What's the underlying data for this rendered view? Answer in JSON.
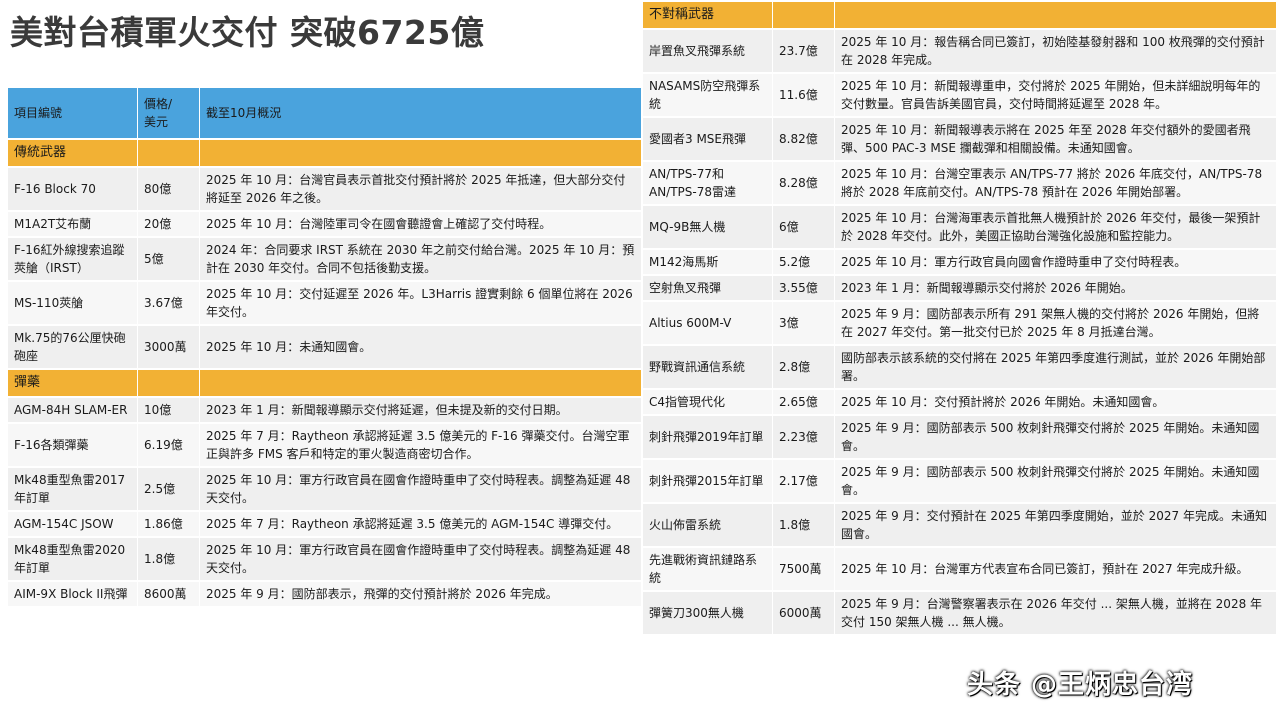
{
  "title": "美對台積軍火交付 突破6725億",
  "headers": {
    "item": "項目編號",
    "price": "價格/\n美元",
    "status": "截至10月概況"
  },
  "left": [
    {
      "type": "cat",
      "label": "傳統武器"
    },
    {
      "type": "row",
      "name": "F-16 Block 70",
      "price": "80億",
      "status": "2025 年 10 月：台灣官員表示首批交付預計將於 2025 年抵達，但大部分交付將延至 2026 年之後。"
    },
    {
      "type": "row",
      "name": "M1A2T艾布蘭",
      "price": "20億",
      "status": "2025 年 10 月：台灣陸軍司令在國會聽證會上確認了交付時程。"
    },
    {
      "type": "row",
      "name": "F-16紅外線搜索追蹤莢艙（IRST）",
      "price": "5億",
      "status": "2024 年：合同要求 IRST 系統在 2030 年之前交付給台灣。2025 年 10 月：預計在 2030 年交付。合同不包括後勤支援。"
    },
    {
      "type": "row",
      "name": "MS-110莢艙",
      "price": "3.67億",
      "status": "2025 年 10 月：交付延遲至 2026 年。L3Harris 證實剩餘 6 個單位將在 2026 年交付。"
    },
    {
      "type": "row",
      "name": "Mk.75的76公厘快砲砲座",
      "price": "3000萬",
      "status": "2025 年 10 月：未通知國會。"
    },
    {
      "type": "cat",
      "label": "彈藥"
    },
    {
      "type": "row",
      "name": "AGM-84H SLAM-ER",
      "price": "10億",
      "status": "2023 年 1 月：新聞報導顯示交付將延遲，但未提及新的交付日期。"
    },
    {
      "type": "row",
      "name": "F-16各類彈藥",
      "price": "6.19億",
      "status": "2025 年 7 月：Raytheon 承認將延遲 3.5 億美元的 F-16 彈藥交付。台灣空軍正與許多 FMS 客戶和特定的軍火製造商密切合作。"
    },
    {
      "type": "row",
      "name": "Mk48重型魚雷2017年訂單",
      "price": "2.5億",
      "status": "2025 年 10 月：軍方行政官員在國會作證時重申了交付時程表。調整為延遲 48 天交付。"
    },
    {
      "type": "row",
      "name": "AGM-154C JSOW",
      "price": "1.86億",
      "status": "2025 年 7 月：Raytheon 承認將延遲 3.5 億美元的 AGM-154C 導彈交付。"
    },
    {
      "type": "row",
      "name": "Mk48重型魚雷2020年訂單",
      "price": "1.8億",
      "status": "2025 年 10 月：軍方行政官員在國會作證時重申了交付時程表。調整為延遲 48 天交付。"
    },
    {
      "type": "row",
      "name": "AIM-9X Block II飛彈",
      "price": "8600萬",
      "status": "2025 年 9 月：國防部表示，飛彈的交付預計將於 2026 年完成。"
    }
  ],
  "right": [
    {
      "type": "cat",
      "label": "不對稱武器"
    },
    {
      "type": "row",
      "name": "岸置魚叉飛彈系統",
      "price": "23.7億",
      "status": "2025 年 10 月：報告稱合同已簽訂，初始陸基發射器和 100 枚飛彈的交付預計在 2028 年完成。"
    },
    {
      "type": "row",
      "name": "NASAMS防空飛彈系統",
      "price": "11.6億",
      "status": "2025 年 10 月：新聞報導重申，交付將於 2025 年開始，但未詳細說明每年的交付數量。官員告訴美國官員，交付時間將延遲至 2028 年。"
    },
    {
      "type": "row",
      "name": "愛國者3 MSE飛彈",
      "price": "8.82億",
      "status": "2025 年 10 月：新聞報導表示將在 2025 年至 2028 年交付額外的愛國者飛彈、500 PAC-3 MSE 攔截彈和相關設備。未通知國會。"
    },
    {
      "type": "row",
      "name": "AN/TPS-77和AN/TPS-78雷達",
      "price": "8.28億",
      "status": "2025 年 10 月：台灣空軍表示 AN/TPS-77 將於 2026 年底交付，AN/TPS-78 將於 2028 年底前交付。AN/TPS-78 預計在 2026 年開始部署。"
    },
    {
      "type": "row",
      "name": "MQ-9B無人機",
      "price": "6億",
      "status": "2025 年 10 月：台灣海軍表示首批無人機預計於 2026 年交付，最後一架預計於 2028 年交付。此外，美國正協助台灣強化設施和監控能力。"
    },
    {
      "type": "row",
      "name": "M142海馬斯",
      "price": "5.2億",
      "status": "2025 年 10 月：軍方行政官員向國會作證時重申了交付時程表。"
    },
    {
      "type": "row",
      "name": "空射魚叉飛彈",
      "price": "3.55億",
      "status": "2023 年 1 月：新聞報導顯示交付將於 2026 年開始。"
    },
    {
      "type": "row",
      "name": "Altius 600M-V",
      "price": "3億",
      "status": "2025 年 9 月：國防部表示所有 291 架無人機的交付將於 2026 年開始，但將在 2027 年交付。第一批交付已於 2025 年 8 月抵達台灣。"
    },
    {
      "type": "row",
      "name": "野戰資訊通信系統",
      "price": "2.8億",
      "status": "國防部表示該系統的交付將在 2025 年第四季度進行測試，並於 2026 年開始部署。"
    },
    {
      "type": "row",
      "name": "C4指管現代化",
      "price": "2.65億",
      "status": "2025 年 10 月：交付預計將於 2026 年開始。未通知國會。"
    },
    {
      "type": "row",
      "name": "刺針飛彈2019年訂單",
      "price": "2.23億",
      "status": "2025 年 9 月：國防部表示 500 枚刺針飛彈交付將於 2025 年開始。未通知國會。"
    },
    {
      "type": "row",
      "name": "刺針飛彈2015年訂單",
      "price": "2.17億",
      "status": "2025 年 9 月：國防部表示 500 枚刺針飛彈交付將於 2025 年開始。未通知國會。"
    },
    {
      "type": "row",
      "name": "火山佈雷系統",
      "price": "1.8億",
      "status": "2025 年 9 月：交付預計在 2025 年第四季度開始，並於 2027 年完成。未通知國會。"
    },
    {
      "type": "row",
      "name": "先進戰術資訊鏈路系統",
      "price": "7500萬",
      "status": "2025 年 10 月：台灣軍方代表宣布合同已簽訂，預計在 2027 年完成升級。"
    },
    {
      "type": "row",
      "name": "彈簧刀300無人機",
      "price": "6000萬",
      "status": "2025 年 9 月：台灣警察署表示在 2026 年交付 ... 架無人機，並將在 2028 年交付 150 架無人機 ... 無人機。"
    }
  ],
  "watermark": "头条 @王炳忠台湾",
  "colors": {
    "header_bg": "#4aa3dd",
    "category_bg": "#f2b134",
    "row_bg": "#efefef"
  }
}
